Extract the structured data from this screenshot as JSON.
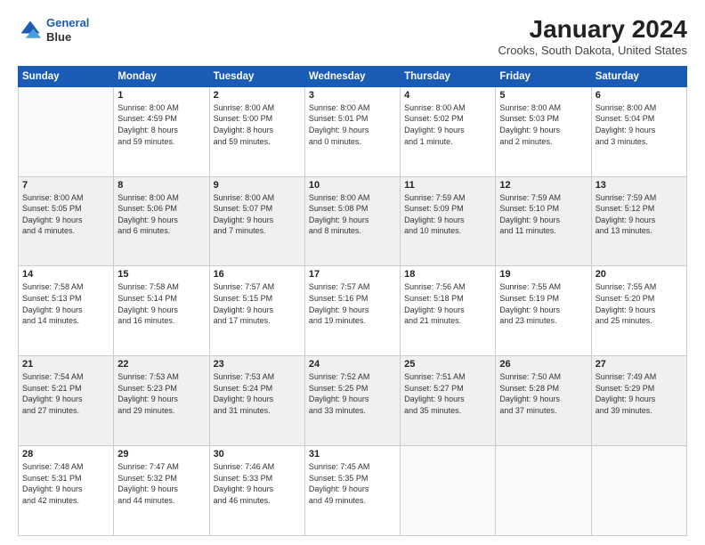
{
  "logo": {
    "line1": "General",
    "line2": "Blue"
  },
  "title": "January 2024",
  "subtitle": "Crooks, South Dakota, United States",
  "days_of_week": [
    "Sunday",
    "Monday",
    "Tuesday",
    "Wednesday",
    "Thursday",
    "Friday",
    "Saturday"
  ],
  "weeks": [
    [
      {
        "num": "",
        "info": ""
      },
      {
        "num": "1",
        "info": "Sunrise: 8:00 AM\nSunset: 4:59 PM\nDaylight: 8 hours\nand 59 minutes."
      },
      {
        "num": "2",
        "info": "Sunrise: 8:00 AM\nSunset: 5:00 PM\nDaylight: 8 hours\nand 59 minutes."
      },
      {
        "num": "3",
        "info": "Sunrise: 8:00 AM\nSunset: 5:01 PM\nDaylight: 9 hours\nand 0 minutes."
      },
      {
        "num": "4",
        "info": "Sunrise: 8:00 AM\nSunset: 5:02 PM\nDaylight: 9 hours\nand 1 minute."
      },
      {
        "num": "5",
        "info": "Sunrise: 8:00 AM\nSunset: 5:03 PM\nDaylight: 9 hours\nand 2 minutes."
      },
      {
        "num": "6",
        "info": "Sunrise: 8:00 AM\nSunset: 5:04 PM\nDaylight: 9 hours\nand 3 minutes."
      }
    ],
    [
      {
        "num": "7",
        "info": "Sunrise: 8:00 AM\nSunset: 5:05 PM\nDaylight: 9 hours\nand 4 minutes."
      },
      {
        "num": "8",
        "info": "Sunrise: 8:00 AM\nSunset: 5:06 PM\nDaylight: 9 hours\nand 6 minutes."
      },
      {
        "num": "9",
        "info": "Sunrise: 8:00 AM\nSunset: 5:07 PM\nDaylight: 9 hours\nand 7 minutes."
      },
      {
        "num": "10",
        "info": "Sunrise: 8:00 AM\nSunset: 5:08 PM\nDaylight: 9 hours\nand 8 minutes."
      },
      {
        "num": "11",
        "info": "Sunrise: 7:59 AM\nSunset: 5:09 PM\nDaylight: 9 hours\nand 10 minutes."
      },
      {
        "num": "12",
        "info": "Sunrise: 7:59 AM\nSunset: 5:10 PM\nDaylight: 9 hours\nand 11 minutes."
      },
      {
        "num": "13",
        "info": "Sunrise: 7:59 AM\nSunset: 5:12 PM\nDaylight: 9 hours\nand 13 minutes."
      }
    ],
    [
      {
        "num": "14",
        "info": "Sunrise: 7:58 AM\nSunset: 5:13 PM\nDaylight: 9 hours\nand 14 minutes."
      },
      {
        "num": "15",
        "info": "Sunrise: 7:58 AM\nSunset: 5:14 PM\nDaylight: 9 hours\nand 16 minutes."
      },
      {
        "num": "16",
        "info": "Sunrise: 7:57 AM\nSunset: 5:15 PM\nDaylight: 9 hours\nand 17 minutes."
      },
      {
        "num": "17",
        "info": "Sunrise: 7:57 AM\nSunset: 5:16 PM\nDaylight: 9 hours\nand 19 minutes."
      },
      {
        "num": "18",
        "info": "Sunrise: 7:56 AM\nSunset: 5:18 PM\nDaylight: 9 hours\nand 21 minutes."
      },
      {
        "num": "19",
        "info": "Sunrise: 7:55 AM\nSunset: 5:19 PM\nDaylight: 9 hours\nand 23 minutes."
      },
      {
        "num": "20",
        "info": "Sunrise: 7:55 AM\nSunset: 5:20 PM\nDaylight: 9 hours\nand 25 minutes."
      }
    ],
    [
      {
        "num": "21",
        "info": "Sunrise: 7:54 AM\nSunset: 5:21 PM\nDaylight: 9 hours\nand 27 minutes."
      },
      {
        "num": "22",
        "info": "Sunrise: 7:53 AM\nSunset: 5:23 PM\nDaylight: 9 hours\nand 29 minutes."
      },
      {
        "num": "23",
        "info": "Sunrise: 7:53 AM\nSunset: 5:24 PM\nDaylight: 9 hours\nand 31 minutes."
      },
      {
        "num": "24",
        "info": "Sunrise: 7:52 AM\nSunset: 5:25 PM\nDaylight: 9 hours\nand 33 minutes."
      },
      {
        "num": "25",
        "info": "Sunrise: 7:51 AM\nSunset: 5:27 PM\nDaylight: 9 hours\nand 35 minutes."
      },
      {
        "num": "26",
        "info": "Sunrise: 7:50 AM\nSunset: 5:28 PM\nDaylight: 9 hours\nand 37 minutes."
      },
      {
        "num": "27",
        "info": "Sunrise: 7:49 AM\nSunset: 5:29 PM\nDaylight: 9 hours\nand 39 minutes."
      }
    ],
    [
      {
        "num": "28",
        "info": "Sunrise: 7:48 AM\nSunset: 5:31 PM\nDaylight: 9 hours\nand 42 minutes."
      },
      {
        "num": "29",
        "info": "Sunrise: 7:47 AM\nSunset: 5:32 PM\nDaylight: 9 hours\nand 44 minutes."
      },
      {
        "num": "30",
        "info": "Sunrise: 7:46 AM\nSunset: 5:33 PM\nDaylight: 9 hours\nand 46 minutes."
      },
      {
        "num": "31",
        "info": "Sunrise: 7:45 AM\nSunset: 5:35 PM\nDaylight: 9 hours\nand 49 minutes."
      },
      {
        "num": "",
        "info": ""
      },
      {
        "num": "",
        "info": ""
      },
      {
        "num": "",
        "info": ""
      }
    ]
  ]
}
